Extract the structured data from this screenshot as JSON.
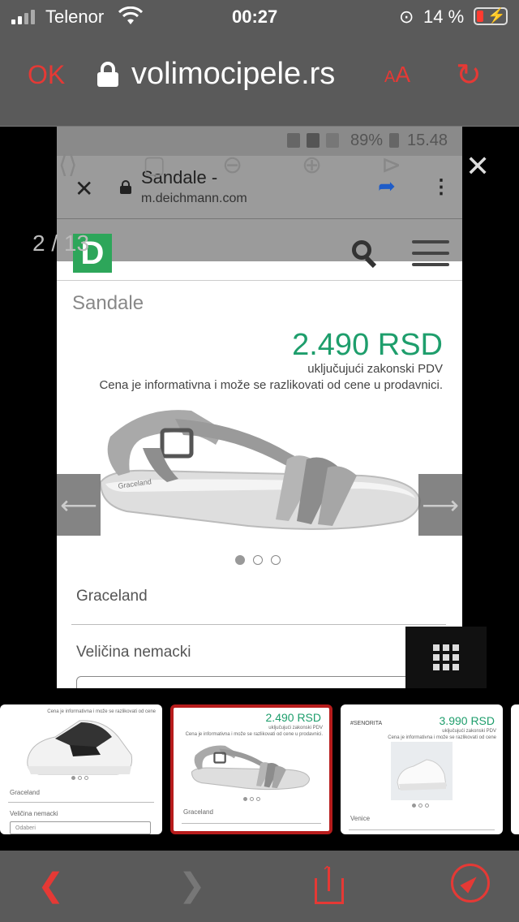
{
  "status": {
    "carrier": "Telenor",
    "time": "00:27",
    "battery": "14 %"
  },
  "browser": {
    "done_label": "OK",
    "domain": "volimocipele.rs",
    "text_size_label": "AA"
  },
  "viewer": {
    "counter": "2 / 13",
    "screenshot": {
      "status": {
        "battery": "89%",
        "time": "15.48"
      },
      "tab_title": "Sandale -",
      "host": "m.deichmann.com",
      "logo_letter": "D",
      "product_name": "Sandale",
      "price": "2.490 RSD",
      "vat_note": "uključujući zakonski PDV",
      "price_note": "Cena je informativna i može se razlikovati od cene u prodavnici.",
      "shoe_label": "Graceland",
      "brand": "Graceland",
      "size_label": "Veličina nemacki"
    }
  },
  "thumbnails": [
    {
      "note": "Cena je informativna i može se razlikovati od cene",
      "brand": "Graceland",
      "size_label": "Veličina nemacki",
      "size_value": "Odaberi"
    },
    {
      "price": "2.490 RSD",
      "vat_note": "uključujući zakonski PDV",
      "note": "Cena je informativna i može se razlikovati od cene u prodavnici.",
      "brand": "Graceland"
    },
    {
      "price": "3.990 RSD",
      "vat_note": "uključujući zakonski PDV",
      "note": "Cena je informativna i može se razlikovati od cene",
      "logo_text": "#SENORITA",
      "brand": "Venice"
    }
  ],
  "colors": {
    "accent_red": "#e53935",
    "price_green": "#1e9e6c",
    "logo_green": "#2da65a",
    "active_thumb_border": "#b71c1c"
  },
  "icons": {
    "viewer_tools": [
      "share-icon",
      "crop-icon",
      "zoom-out-icon",
      "zoom-in-icon",
      "play-icon"
    ]
  }
}
